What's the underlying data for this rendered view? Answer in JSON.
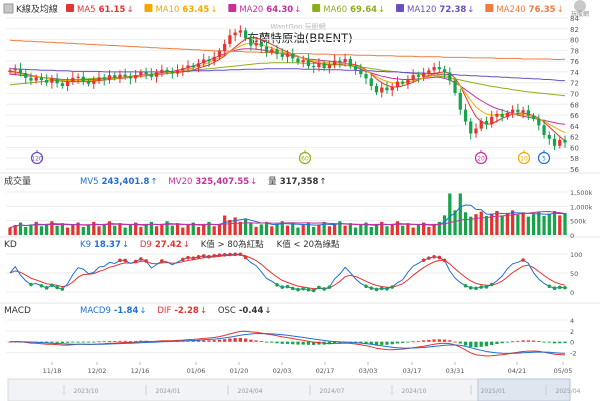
{
  "header": {
    "title": "K線及均線",
    "ma": [
      {
        "label": "MA5",
        "value": "61.15",
        "arrow": "↓",
        "color": "#e3342f"
      },
      {
        "label": "MA10",
        "value": "63.45",
        "arrow": "↓",
        "color": "#f2a900"
      },
      {
        "label": "MA20",
        "value": "64.30",
        "arrow": "↓",
        "color": "#c6309a"
      },
      {
        "label": "MA60",
        "value": "69.64",
        "arrow": "↓",
        "color": "#8fae1b"
      },
      {
        "label": "MA120",
        "value": "72.38",
        "arrow": "↓",
        "color": "#6b4fbf"
      },
      {
        "label": "MA240",
        "value": "76.35",
        "arrow": "↓",
        "color": "#f07b3c"
      }
    ]
  },
  "watermark": "WantGoo 玩股網",
  "brand": "玩股網",
  "chart_title": "布蘭特原油(BRENT)",
  "panels": {
    "volume": {
      "title": "成交量",
      "legend": [
        {
          "label": "MV5",
          "value": "243,401.8",
          "arrow": "↑",
          "color": "#1f6fd6"
        },
        {
          "label": "MV20",
          "value": "325,407.55",
          "arrow": "↓",
          "color": "#c6309a"
        },
        {
          "label": "量",
          "value": "317,358",
          "arrow": "↑",
          "color": "#333333"
        }
      ],
      "ticks": [
        "1,500k",
        "1,000k",
        "500k",
        "0"
      ]
    },
    "kd": {
      "title": "KD",
      "legend": [
        {
          "label": "K9",
          "value": "18.37",
          "arrow": "↓",
          "color": "#1f6fd6"
        },
        {
          "label": "D9",
          "value": "27.42",
          "arrow": "↓",
          "color": "#e3342f"
        },
        {
          "label": "K值 > 80為紅點",
          "value": "",
          "arrow": "",
          "color": "#333333"
        },
        {
          "label": "K值 < 20為綠點",
          "value": "",
          "arrow": "",
          "color": "#333333"
        }
      ],
      "ticks": [
        "100",
        "50",
        "0"
      ]
    },
    "macd": {
      "title": "MACD",
      "legend": [
        {
          "label": "MACD9",
          "value": "-1.84",
          "arrow": "↓",
          "color": "#1f6fd6"
        },
        {
          "label": "DIF",
          "value": "-2.28",
          "arrow": "↓",
          "color": "#e3342f"
        },
        {
          "label": "OSC",
          "value": "-0.44",
          "arrow": "↓",
          "color": "#333333"
        }
      ],
      "ticks": [
        "4",
        "2",
        "0",
        "-2"
      ]
    }
  },
  "price_axis": [
    "84",
    "82",
    "80",
    "78",
    "76",
    "74",
    "72",
    "70",
    "68",
    "66",
    "64",
    "62",
    "60",
    "58",
    "56"
  ],
  "markers": [
    "120",
    "60",
    "20",
    "10",
    "5"
  ],
  "dates": [
    "11/18",
    "12/02",
    "12/16",
    "01/06",
    "01/20",
    "02/03",
    "02/17",
    "03/03",
    "03/17",
    "03/31",
    "04/21",
    "05/05"
  ],
  "navigator": [
    "2023/10",
    "2024/01",
    "2024/04",
    "2024/07",
    "2024/10",
    "2025/01",
    "2025/04"
  ],
  "chart_data": {
    "type": "candlestick",
    "title": "布蘭特原油(BRENT)",
    "ylim": [
      56,
      84
    ],
    "close": [
      74.3,
      74.6,
      73.8,
      72.9,
      72.4,
      73.0,
      72.5,
      72.0,
      72.8,
      71.9,
      71.4,
      72.2,
      72.9,
      73.1,
      72.3,
      71.8,
      72.4,
      73.0,
      72.6,
      73.4,
      72.9,
      73.5,
      73.2,
      72.8,
      73.4,
      74.0,
      73.6,
      73.1,
      73.9,
      74.4,
      74.0,
      73.7,
      74.3,
      74.7,
      75.2,
      74.9,
      75.6,
      76.3,
      76.0,
      76.8,
      77.9,
      79.2,
      80.8,
      81.3,
      81.7,
      80.2,
      78.9,
      79.4,
      78.7,
      77.6,
      78.2,
      77.3,
      76.8,
      77.4,
      76.5,
      75.8,
      76.2,
      75.1,
      74.9,
      75.6,
      74.7,
      75.3,
      76.1,
      75.8,
      76.4,
      75.1,
      74.4,
      73.6,
      72.8,
      71.4,
      70.2,
      71.1,
      70.6,
      71.3,
      72.2,
      71.8,
      72.6,
      73.4,
      73.1,
      73.8,
      74.3,
      74.9,
      74.5,
      73.9,
      72.4,
      70.1,
      67.0,
      64.8,
      62.6,
      63.5,
      64.9,
      64.3,
      65.7,
      66.2,
      65.6,
      66.4,
      67.0,
      66.5,
      66.9,
      65.9,
      65.3,
      64.1,
      62.3,
      61.6,
      60.3,
      61.4,
      60.9
    ],
    "ma": {
      "MA5": [
        74.1,
        74.0,
        73.8,
        73.6,
        73.4,
        73.2,
        73.0,
        72.8,
        72.6,
        72.4,
        72.3,
        72.2,
        72.2,
        72.2,
        72.2,
        72.2,
        72.3,
        72.4,
        72.5,
        72.6,
        72.7,
        72.8,
        72.9,
        73.0,
        73.1,
        73.2,
        73.3,
        73.4,
        73.5,
        73.6,
        73.7,
        73.8,
        73.9,
        74.0,
        74.2,
        74.4,
        74.7,
        75.0,
        75.3,
        75.8,
        76.3,
        77.0,
        77.8,
        78.6,
        79.4,
        80.1,
        80.4,
        80.3,
        80.0,
        79.6,
        79.1,
        78.6,
        78.1,
        77.7,
        77.3,
        76.9,
        76.5,
        76.1,
        75.8,
        75.6,
        75.4,
        75.3,
        75.3,
        75.4,
        75.5,
        75.5,
        75.3,
        75.0,
        74.4,
        73.6,
        72.7,
        72.0,
        71.5,
        71.2,
        71.2,
        71.4,
        71.7,
        72.1,
        72.5,
        72.9,
        73.3,
        73.7,
        73.9,
        74.0,
        73.7,
        72.9,
        71.4,
        69.4,
        67.4,
        65.7,
        64.8,
        64.3,
        64.4,
        64.9,
        65.4,
        65.8,
        66.2,
        66.3,
        66.4,
        66.2,
        65.9,
        65.4,
        64.7,
        63.8,
        62.9,
        62.0,
        61.2
      ],
      "MA20": [
        73.6,
        73.5,
        73.4,
        73.3,
        73.2,
        73.1,
        73.0,
        72.9,
        72.8,
        72.7,
        72.6,
        72.6,
        72.6,
        72.6,
        72.6,
        72.6,
        72.6,
        72.7,
        72.7,
        72.8,
        72.9,
        73.0,
        73.1,
        73.2,
        73.3,
        73.4,
        73.5,
        73.6,
        73.7,
        73.8,
        73.9,
        74.1,
        74.3,
        74.5,
        74.8,
        75.1,
        75.4,
        75.8,
        76.2,
        76.6,
        77.0,
        77.4,
        77.7,
        78.0,
        78.2,
        78.3,
        78.3,
        78.2,
        78.1,
        77.9,
        77.8,
        77.6,
        77.4,
        77.2,
        77.0,
        76.8,
        76.6,
        76.4,
        76.3,
        76.2,
        76.1,
        76.0,
        75.9,
        75.8,
        75.6,
        75.3,
        74.9,
        74.5,
        74.1,
        73.8,
        73.5,
        73.2,
        73.0,
        72.8,
        72.7,
        72.6,
        72.6,
        72.6,
        72.7,
        72.8,
        72.9,
        73.0,
        73.0,
        72.8,
        72.5,
        72.0,
        71.4,
        70.7,
        70.0,
        69.3,
        68.7,
        68.1,
        67.6,
        67.2,
        66.9,
        66.6,
        66.3,
        66.0,
        65.8,
        65.6,
        65.4,
        65.2,
        65.0,
        64.8,
        64.6,
        64.4,
        64.3
      ],
      "MA60": [
        71.6,
        71.7,
        71.8,
        71.9,
        72.0,
        72.1,
        72.2,
        72.3,
        72.4,
        72.4,
        72.5,
        72.5,
        72.6,
        72.6,
        72.7,
        72.7,
        72.8,
        72.8,
        72.9,
        72.9,
        73.0,
        73.0,
        73.1,
        73.1,
        73.2,
        73.3,
        73.4,
        73.5,
        73.6,
        73.7,
        73.8,
        73.9,
        74.0,
        74.1,
        74.2,
        74.3,
        74.4,
        74.5,
        74.6,
        74.7,
        74.8,
        74.9,
        75.0,
        75.1,
        75.2,
        75.3,
        75.4,
        75.5,
        75.6,
        75.6,
        75.7,
        75.7,
        75.7,
        75.7,
        75.7,
        75.7,
        75.6,
        75.6,
        75.6,
        75.5,
        75.5,
        75.4,
        75.4,
        75.3,
        75.2,
        75.1,
        75.0,
        74.9,
        74.8,
        74.6,
        74.5,
        74.3,
        74.2,
        74.1,
        74.0,
        73.9,
        73.8,
        73.7,
        73.6,
        73.5,
        73.4,
        73.3,
        73.2,
        73.1,
        72.9,
        72.7,
        72.5,
        72.3,
        72.1,
        71.9,
        71.7,
        71.5,
        71.3,
        71.2,
        71.0,
        70.9,
        70.7,
        70.6,
        70.4,
        70.3,
        70.2,
        70.1,
        70.0,
        69.9,
        69.8,
        69.7,
        69.6
      ],
      "MA120": [
        74.6,
        74.6,
        74.5,
        74.5,
        74.4,
        74.4,
        74.3,
        74.3,
        74.3,
        74.2,
        74.2,
        74.2,
        74.1,
        74.1,
        74.1,
        74.1,
        74.1,
        74.1,
        74.0,
        74.0,
        74.0,
        74.0,
        74.0,
        74.0,
        74.0,
        74.0,
        74.0,
        74.0,
        74.0,
        74.0,
        74.1,
        74.1,
        74.1,
        74.1,
        74.1,
        74.2,
        74.2,
        74.2,
        74.2,
        74.3,
        74.3,
        74.3,
        74.4,
        74.4,
        74.4,
        74.5,
        74.5,
        74.5,
        74.5,
        74.6,
        74.6,
        74.6,
        74.6,
        74.6,
        74.6,
        74.6,
        74.5,
        74.5,
        74.5,
        74.5,
        74.4,
        74.4,
        74.4,
        74.4,
        74.3,
        74.3,
        74.3,
        74.2,
        74.2,
        74.2,
        74.1,
        74.1,
        74.0,
        74.0,
        74.0,
        73.9,
        73.9,
        73.8,
        73.8,
        73.8,
        73.7,
        73.7,
        73.6,
        73.6,
        73.5,
        73.5,
        73.4,
        73.4,
        73.3,
        73.3,
        73.2,
        73.2,
        73.1,
        73.1,
        73.0,
        73.0,
        72.9,
        72.9,
        72.8,
        72.8,
        72.7,
        72.7,
        72.6,
        72.6,
        72.5,
        72.4,
        72.4
      ],
      "MA240": [
        79.9,
        79.8,
        79.8,
        79.7,
        79.7,
        79.6,
        79.6,
        79.5,
        79.5,
        79.4,
        79.4,
        79.3,
        79.3,
        79.2,
        79.2,
        79.1,
        79.1,
        79.0,
        79.0,
        78.9,
        78.9,
        78.8,
        78.8,
        78.7,
        78.7,
        78.6,
        78.6,
        78.5,
        78.5,
        78.4,
        78.4,
        78.3,
        78.3,
        78.2,
        78.2,
        78.1,
        78.1,
        78.0,
        78.0,
        77.9,
        77.9,
        77.9,
        77.8,
        77.8,
        77.8,
        77.7,
        77.7,
        77.7,
        77.6,
        77.6,
        77.6,
        77.5,
        77.5,
        77.5,
        77.4,
        77.4,
        77.4,
        77.4,
        77.3,
        77.3,
        77.3,
        77.3,
        77.2,
        77.2,
        77.2,
        77.2,
        77.1,
        77.1,
        77.1,
        77.1,
        77.0,
        77.0,
        77.0,
        77.0,
        76.9,
        76.9,
        76.9,
        76.9,
        76.8,
        76.8,
        76.8,
        76.8,
        76.8,
        76.7,
        76.7,
        76.7,
        76.7,
        76.7,
        76.6,
        76.6,
        76.6,
        76.6,
        76.6,
        76.5,
        76.5,
        76.5,
        76.5,
        76.5,
        76.4,
        76.4,
        76.4,
        76.4,
        76.4,
        76.4,
        76.3,
        76.3,
        76.35
      ]
    }
  }
}
